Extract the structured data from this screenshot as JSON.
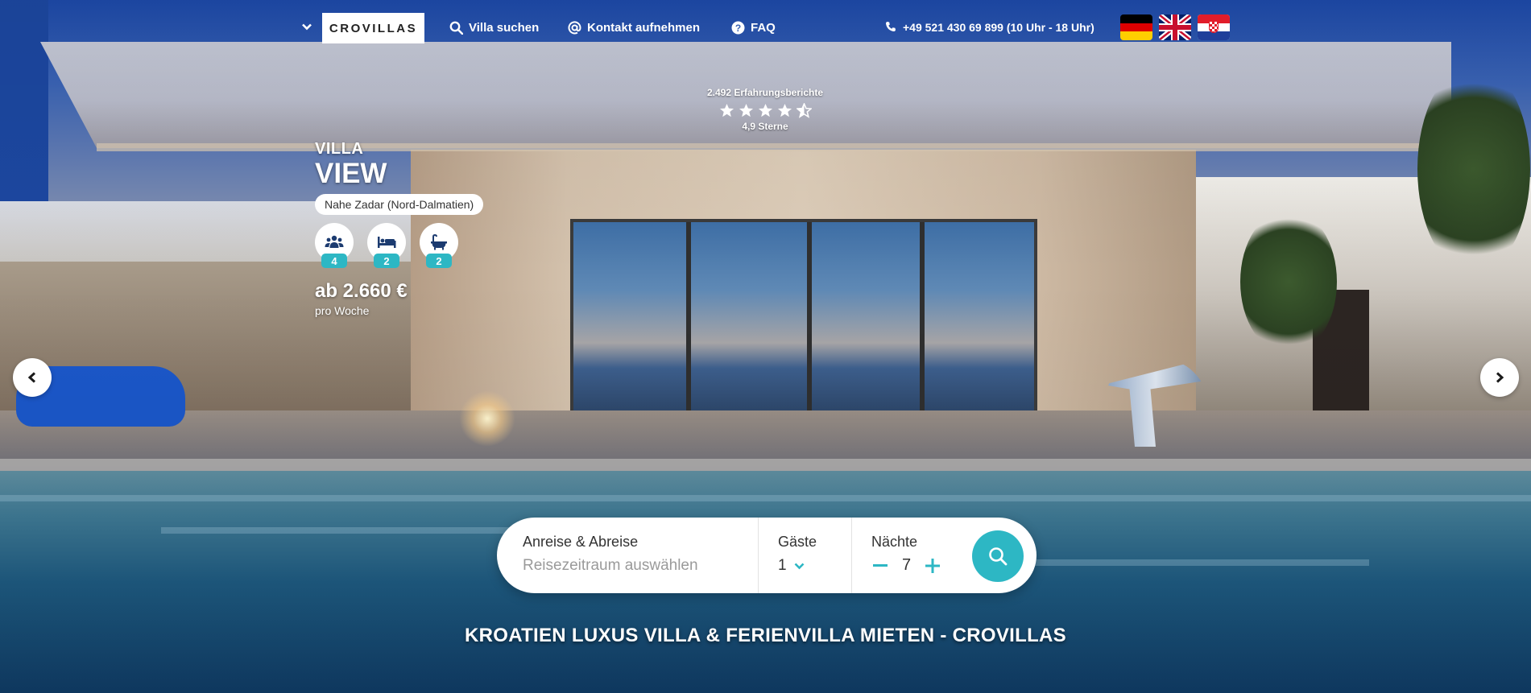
{
  "nav": {
    "logo": "CROVILLAS",
    "links": [
      {
        "label": "Villa suchen",
        "icon": "search-icon"
      },
      {
        "label": "Kontakt aufnehmen",
        "icon": "at-icon"
      },
      {
        "label": "FAQ",
        "icon": "question-icon"
      }
    ],
    "phone": "+49 521 430 69 899  (10 Uhr - 18 Uhr)",
    "languages": [
      "de-flag",
      "uk-flag",
      "hr-flag"
    ]
  },
  "rating": {
    "count_text": "2.492 Erfahrungsberichte",
    "stars": 4.5,
    "score_text": "4,9 Sterne"
  },
  "villa": {
    "pre_title": "VILLA",
    "name": "VIEW",
    "location": "Nahe Zadar (Nord-Dalmatien)",
    "features": [
      {
        "icon": "guests-icon",
        "value": "4"
      },
      {
        "icon": "bed-icon",
        "value": "2"
      },
      {
        "icon": "bath-icon",
        "value": "2"
      }
    ],
    "price": "ab 2.660 €",
    "price_period": "pro Woche"
  },
  "search": {
    "dates_label": "Anreise & Abreise",
    "dates_placeholder": "Reisezeitraum auswählen",
    "guests_label": "Gäste",
    "guests_value": "1",
    "nights_label": "Nächte",
    "nights_value": "7"
  },
  "headline": "KROATIEN LUXUS VILLA & FERIENVILLA MIETEN - CROVILLAS",
  "colors": {
    "accent": "#2db7c4",
    "white": "#ffffff"
  }
}
